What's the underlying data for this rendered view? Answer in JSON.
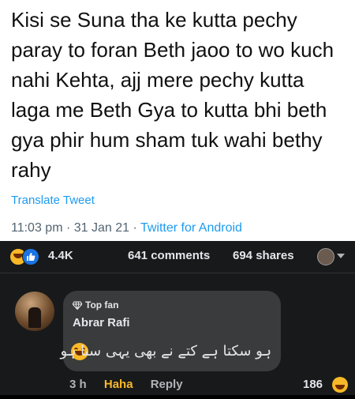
{
  "tweet": {
    "text": "Kisi se Suna tha ke kutta pechy paray to foran Beth jaoo to wo kuch nahi Kehta, ajj mere pechy kutta laga me Beth Gya to kutta bhi beth gya phir hum sham tuk wahi bethy rahy",
    "translate_label": "Translate Tweet",
    "time": "11:03 pm",
    "date": "31 Jan 21",
    "separator": " · ",
    "client": "Twitter for Android"
  },
  "facebook": {
    "reaction_count": "4.4K",
    "comments": "641 comments",
    "shares": "694 shares",
    "reaction_icons": [
      "haha-icon",
      "like-icon"
    ],
    "comment": {
      "badge": "Top fan",
      "author": "Abrar Rafi",
      "text": "ہو سکتا ہے کتے نے بھی یہی سنا ہو",
      "time": "3 h",
      "haha_label": "Haha",
      "reply_label": "Reply",
      "reaction_count": "186"
    }
  },
  "colors": {
    "twitter_blue": "#1d9bf0",
    "haha_yellow": "#f7b928",
    "like_blue": "#1b74e4",
    "dark_bg": "#18191a",
    "bubble": "#3a3b3c"
  }
}
